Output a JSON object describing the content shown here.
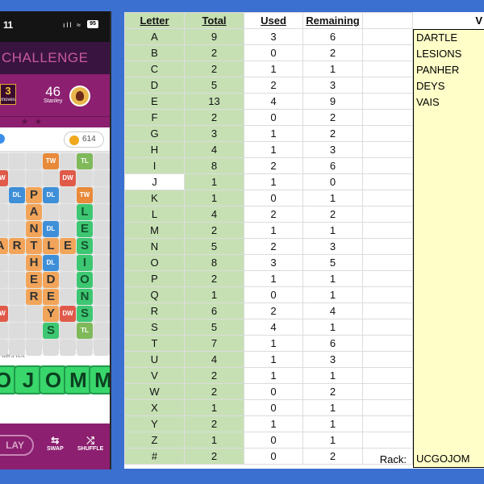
{
  "phone": {
    "status": {
      "time": "11",
      "icons": "ıll ≈",
      "battery": "95"
    },
    "title": "CHALLENGE",
    "moves": {
      "value": "3",
      "label": "moves"
    },
    "opponent": {
      "score": "46",
      "name": "Stanley"
    },
    "coins": "614",
    "letters_left": "tters left",
    "rack": [
      "O",
      "J",
      "O",
      "M",
      "M"
    ],
    "buttons": {
      "play": "LAY",
      "swap": "SWAP",
      "shuffle": "SHUFFLE"
    },
    "bonus": {
      "tw": "TW",
      "dw": "DW",
      "dl": "DL",
      "tl": "TL"
    }
  },
  "sheet": {
    "headers": {
      "letter": "Letter",
      "total": "Total",
      "used": "Used",
      "remaining": "Remaining",
      "words": "V"
    },
    "rows": [
      {
        "l": "A",
        "t": "9",
        "u": "3",
        "r": "6"
      },
      {
        "l": "B",
        "t": "2",
        "u": "0",
        "r": "2"
      },
      {
        "l": "C",
        "t": "2",
        "u": "1",
        "r": "1"
      },
      {
        "l": "D",
        "t": "5",
        "u": "2",
        "r": "3"
      },
      {
        "l": "E",
        "t": "13",
        "u": "4",
        "r": "9"
      },
      {
        "l": "F",
        "t": "2",
        "u": "0",
        "r": "2"
      },
      {
        "l": "G",
        "t": "3",
        "u": "1",
        "r": "2"
      },
      {
        "l": "H",
        "t": "4",
        "u": "1",
        "r": "3"
      },
      {
        "l": "I",
        "t": "8",
        "u": "2",
        "r": "6"
      },
      {
        "l": "J",
        "t": "1",
        "u": "1",
        "r": "0"
      },
      {
        "l": "K",
        "t": "1",
        "u": "0",
        "r": "1"
      },
      {
        "l": "L",
        "t": "4",
        "u": "2",
        "r": "2"
      },
      {
        "l": "M",
        "t": "2",
        "u": "1",
        "r": "1"
      },
      {
        "l": "N",
        "t": "5",
        "u": "2",
        "r": "3"
      },
      {
        "l": "O",
        "t": "8",
        "u": "3",
        "r": "5"
      },
      {
        "l": "P",
        "t": "2",
        "u": "1",
        "r": "1"
      },
      {
        "l": "Q",
        "t": "1",
        "u": "0",
        "r": "1"
      },
      {
        "l": "R",
        "t": "6",
        "u": "2",
        "r": "4"
      },
      {
        "l": "S",
        "t": "5",
        "u": "4",
        "r": "1"
      },
      {
        "l": "T",
        "t": "7",
        "u": "1",
        "r": "6"
      },
      {
        "l": "U",
        "t": "4",
        "u": "1",
        "r": "3"
      },
      {
        "l": "V",
        "t": "2",
        "u": "1",
        "r": "1"
      },
      {
        "l": "W",
        "t": "2",
        "u": "0",
        "r": "2"
      },
      {
        "l": "X",
        "t": "1",
        "u": "0",
        "r": "1"
      },
      {
        "l": "Y",
        "t": "2",
        "u": "1",
        "r": "1"
      },
      {
        "l": "Z",
        "t": "1",
        "u": "0",
        "r": "1"
      },
      {
        "l": "#",
        "t": "2",
        "u": "0",
        "r": "2"
      }
    ],
    "words": [
      "DARTLE",
      "LESIONS",
      "PANHER",
      "DEYS",
      "VAIS"
    ],
    "rack_label": "Rack:",
    "rack_value": "UCGOJOM"
  }
}
